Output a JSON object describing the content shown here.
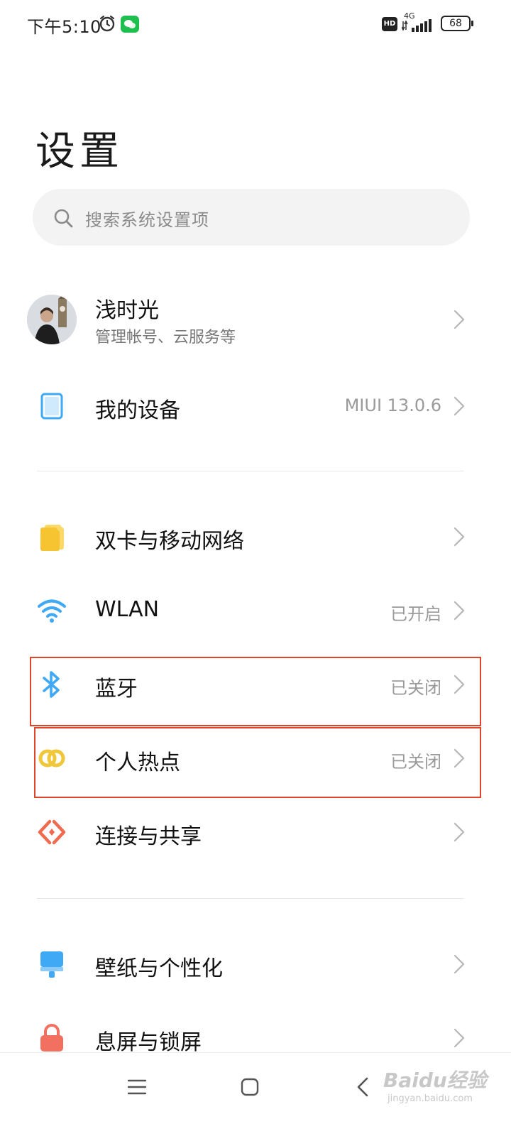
{
  "status_bar": {
    "time": "下午5:10",
    "network": "4G",
    "battery": "68",
    "hd": "HD"
  },
  "page": {
    "title": "设置"
  },
  "search": {
    "placeholder": "搜索系统设置项"
  },
  "account": {
    "name": "浅时光",
    "subtitle": "管理帐号、云服务等"
  },
  "items": [
    {
      "label": "我的设备",
      "value": "MIUI 13.0.6",
      "icon": "tablet-icon"
    },
    {
      "label": "双卡与移动网络",
      "value": "",
      "icon": "sim-card-icon"
    },
    {
      "label": "WLAN",
      "value": "已开启",
      "icon": "wifi-icon"
    },
    {
      "label": "蓝牙",
      "value": "已关闭",
      "icon": "bluetooth-icon"
    },
    {
      "label": "个人热点",
      "value": "已关闭",
      "icon": "hotspot-icon"
    },
    {
      "label": "连接与共享",
      "value": "",
      "icon": "connection-share-icon"
    },
    {
      "label": "壁纸与个性化",
      "value": "",
      "icon": "wallpaper-icon"
    },
    {
      "label": "息屏与锁屏",
      "value": "",
      "icon": "lock-icon"
    }
  ],
  "watermark": {
    "brand": "Baidu经验",
    "url": "jingyan.baidu.com"
  },
  "colors": {
    "accent_blue": "#3fa9f5",
    "sim_yellow": "#f7c431",
    "hotspot_yellow": "#f0c63b",
    "share_red": "#ef6a4f",
    "lock_red": "#f27060",
    "highlight_red": "#e0442a"
  }
}
